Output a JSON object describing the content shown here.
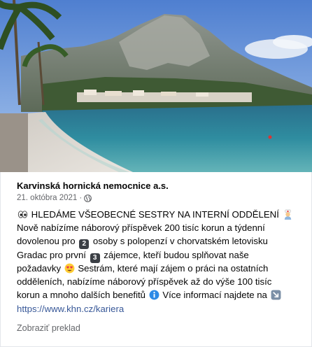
{
  "post": {
    "image_alt": "Beach with mountain and sea",
    "page_name": "Karvinská hornická nemocnice a.s.",
    "date": "21. októbra 2021",
    "date_separator": "·",
    "audience_icon": "globe-icon",
    "lines": [
      {
        "parts": [
          {
            "t": "emoji",
            "icon": "eyes-icon"
          },
          {
            "t": "text",
            "v": " HLEDÁME VŠEOBECNÉ SESTRY NA INTERNÍ ODDĚLENÍ "
          },
          {
            "t": "emoji",
            "icon": "nurse-icon"
          }
        ]
      },
      {
        "parts": [
          {
            "t": "text",
            "v": "Nově nabízíme náborový příspěvek 200 tisíc korun a týdenní"
          }
        ]
      },
      {
        "parts": [
          {
            "t": "text",
            "v": "dovolenou pro "
          },
          {
            "t": "keycap",
            "v": "2"
          },
          {
            "t": "text",
            "v": " osoby s polopenzí v chorvatském letovisku"
          }
        ]
      },
      {
        "parts": [
          {
            "t": "text",
            "v": "Gradac pro první "
          },
          {
            "t": "keycap",
            "v": "3"
          },
          {
            "t": "text",
            "v": " zájemce, kteří budou splňovat naše"
          }
        ]
      },
      {
        "parts": [
          {
            "t": "text",
            "v": "požadavky "
          },
          {
            "t": "emoji",
            "icon": "heart-eyes-icon"
          },
          {
            "t": "text",
            "v": " Sestrám, které mají zájem o práci na ostatních"
          }
        ]
      },
      {
        "parts": [
          {
            "t": "text",
            "v": "odděleních, nabízíme náborový příspěvek až do výše 100 tisíc"
          }
        ]
      },
      {
        "parts": [
          {
            "t": "text",
            "v": "korun a mnoho dalších benefitů "
          },
          {
            "t": "emoji",
            "icon": "info-icon"
          },
          {
            "t": "text",
            "v": " Více informací najdete na "
          },
          {
            "t": "emoji",
            "icon": "down-right-arrow-icon"
          }
        ]
      }
    ],
    "link": "https://www.khn.cz/kariera",
    "translate_label": "Zobraziť preklad"
  },
  "colors": {
    "link": "#385898",
    "meta": "#65676b",
    "text": "#050505"
  }
}
